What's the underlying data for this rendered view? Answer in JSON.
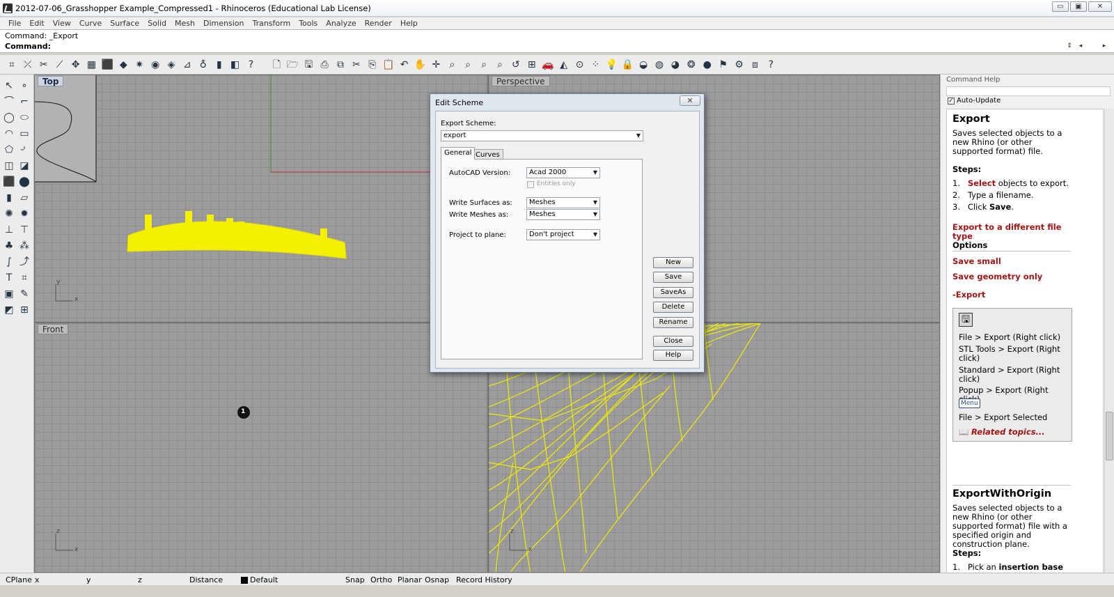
{
  "window": {
    "title": "2012-07-06_Grasshopper Example_Compressed1 - Rhinoceros (Educational Lab License)",
    "min_glyph": "▭",
    "max_glyph": "▣",
    "close_glyph": "✕"
  },
  "menu": [
    "File",
    "Edit",
    "View",
    "Curve",
    "Surface",
    "Solid",
    "Mesh",
    "Dimension",
    "Transform",
    "Tools",
    "Analyze",
    "Render",
    "Help"
  ],
  "command": {
    "history": "Command: _Export",
    "prompt": "Command:",
    "input_value": "",
    "spin_glyph": "⇕",
    "left_glyph": "◂",
    "right_glyph": "▸"
  },
  "toolbar_icons": [
    {
      "name": "snap-icon",
      "glyph": "⌗"
    },
    {
      "name": "curve-tools-icon",
      "glyph": "⤫"
    },
    {
      "name": "trim-icon",
      "glyph": "✂"
    },
    {
      "name": "split-icon",
      "glyph": "⟋"
    },
    {
      "name": "move-icon",
      "glyph": "✥"
    },
    {
      "name": "array-icon",
      "glyph": "▦"
    },
    {
      "name": "box-icon",
      "glyph": "⬛"
    },
    {
      "name": "solid-tools-icon",
      "glyph": "◆"
    },
    {
      "name": "mesh-icon",
      "glyph": "✷"
    },
    {
      "name": "render-icon",
      "glyph": "◉"
    },
    {
      "name": "material-icon",
      "glyph": "◈"
    },
    {
      "name": "dimension-icon",
      "glyph": "⊿"
    },
    {
      "name": "light-icon",
      "glyph": "♁"
    },
    {
      "name": "analyze-icon",
      "glyph": "▮"
    },
    {
      "name": "layer-icon",
      "glyph": "◧"
    },
    {
      "name": "help-icon",
      "glyph": "?"
    },
    {
      "name": "new-file-icon",
      "glyph": "🗋"
    },
    {
      "name": "open-folder-icon",
      "glyph": "🗁"
    },
    {
      "name": "save-icon",
      "glyph": "🖫"
    },
    {
      "name": "print-icon",
      "glyph": "⎙"
    },
    {
      "name": "copy-icon",
      "glyph": "⧉"
    },
    {
      "name": "cut-icon",
      "glyph": "✂"
    },
    {
      "name": "paste-icon",
      "glyph": "⎘"
    },
    {
      "name": "clipboard-icon",
      "glyph": "📋"
    },
    {
      "name": "undo-icon",
      "glyph": "↶"
    },
    {
      "name": "pan-icon",
      "glyph": "✋"
    },
    {
      "name": "rotate-view-icon",
      "glyph": "✛"
    },
    {
      "name": "zoom-icon",
      "glyph": "⌕"
    },
    {
      "name": "zoom-window-icon",
      "glyph": "⌕"
    },
    {
      "name": "zoom-extents-icon",
      "glyph": "⌕"
    },
    {
      "name": "zoom-selected-icon",
      "glyph": "⌕"
    },
    {
      "name": "zoom-previous-icon",
      "glyph": "↺"
    },
    {
      "name": "four-views-icon",
      "glyph": "⊞"
    },
    {
      "name": "car-icon",
      "glyph": "🚗"
    },
    {
      "name": "shaded-icon",
      "glyph": "◭"
    },
    {
      "name": "cplane-icon",
      "glyph": "⊙"
    },
    {
      "name": "points-icon",
      "glyph": "⁘"
    },
    {
      "name": "lightbulb-icon",
      "glyph": "💡"
    },
    {
      "name": "lock-icon",
      "glyph": "🔒"
    },
    {
      "name": "shield-icon",
      "glyph": "◒"
    },
    {
      "name": "color-wheel-icon",
      "glyph": "◍"
    },
    {
      "name": "sphere-icon",
      "glyph": "◕"
    },
    {
      "name": "gear-sphere-icon",
      "glyph": "❂"
    },
    {
      "name": "globe-icon",
      "glyph": "●"
    },
    {
      "name": "flag-icon",
      "glyph": "⚑"
    },
    {
      "name": "gear-icon",
      "glyph": "⚙"
    },
    {
      "name": "grid-icon",
      "glyph": "⧈"
    },
    {
      "name": "help-topic-icon",
      "glyph": "?"
    }
  ],
  "left_tools": [
    {
      "name": "select-arrow-icon",
      "glyph": "↖"
    },
    {
      "name": "point-icon",
      "glyph": "∘"
    },
    {
      "name": "polyline-icon",
      "glyph": "⌒"
    },
    {
      "name": "curve-cv-icon",
      "glyph": "⌐"
    },
    {
      "name": "circle-icon",
      "glyph": "◯"
    },
    {
      "name": "ellipse-icon",
      "glyph": "⬭"
    },
    {
      "name": "arc-icon",
      "glyph": "◠"
    },
    {
      "name": "rectangle-icon",
      "glyph": "▭"
    },
    {
      "name": "polygon-icon",
      "glyph": "⬠"
    },
    {
      "name": "fillet-icon",
      "glyph": "⌏"
    },
    {
      "name": "surface-icon",
      "glyph": "◫"
    },
    {
      "name": "surface-edit-icon",
      "glyph": "◪"
    },
    {
      "name": "box-solid-icon",
      "glyph": "⬛"
    },
    {
      "name": "boolean-icon",
      "glyph": "⬤"
    },
    {
      "name": "cylinder-icon",
      "glyph": "▮"
    },
    {
      "name": "plane-icon",
      "glyph": "▱"
    },
    {
      "name": "transform-gear-icon",
      "glyph": "✺"
    },
    {
      "name": "explode-icon",
      "glyph": "✹"
    },
    {
      "name": "align-icon",
      "glyph": "⊥"
    },
    {
      "name": "distribute-icon",
      "glyph": "⊤"
    },
    {
      "name": "group-icon",
      "glyph": "♣"
    },
    {
      "name": "cluster-icon",
      "glyph": "⁂"
    },
    {
      "name": "blend-icon",
      "glyph": "∫"
    },
    {
      "name": "sweep-icon",
      "glyph": "⤴"
    },
    {
      "name": "text-icon",
      "glyph": "T"
    },
    {
      "name": "block-icon",
      "glyph": "⌗"
    },
    {
      "name": "array-grid-icon",
      "glyph": "▣"
    },
    {
      "name": "edit-curve-icon",
      "glyph": "✎"
    },
    {
      "name": "view-cube-icon",
      "glyph": "◩"
    },
    {
      "name": "dim-tool-icon",
      "glyph": "⊞"
    }
  ],
  "viewports": {
    "top": {
      "label": "Top",
      "axis_x": "x",
      "axis_y": "y"
    },
    "perspective": {
      "label": "Perspective"
    },
    "front": {
      "label": "Front",
      "axis_x": "x",
      "axis_z": "z",
      "marker": "1"
    },
    "right": {
      "axis_x": "x",
      "axis_z": "z"
    }
  },
  "dialog": {
    "title": "Edit Scheme",
    "close_glyph": "✕",
    "export_scheme_label": "Export Scheme:",
    "export_scheme_value": "export",
    "tabs": [
      "General",
      "Curves"
    ],
    "autocad_label": "AutoCAD Version:",
    "autocad_value": "Acad 2000",
    "entities_only_label": "Entities only",
    "write_surfaces_label": "Write Surfaces as:",
    "write_surfaces_value": "Meshes",
    "write_meshes_label": "Write Meshes as:",
    "write_meshes_value": "Meshes",
    "project_label": "Project to plane:",
    "project_value": "Don't project",
    "buttons": {
      "new": "New",
      "save": "Save",
      "saveas": "SaveAs",
      "delete": "Delete",
      "rename": "Rename",
      "close": "Close",
      "help": "Help"
    }
  },
  "help": {
    "header": "Command Help",
    "auto_update": "Auto-Update",
    "check_glyph": "✓",
    "title": "Export",
    "desc": "Saves selected objects to a new Rhino (or other supported format) file.",
    "steps_header": "Steps:",
    "step1_num": "1.",
    "step1_link": "Select",
    "step1_rest": "objects to export.",
    "step2_num": "2.",
    "step2": "Type a filename.",
    "step3_num": "3.",
    "step3_pre": "Click",
    "step3_bold": "Save",
    "export_diff": "Export to a different file type",
    "options_header": "Options",
    "save_small": "Save small",
    "save_geometry": "Save geometry only",
    "dash_export": "-Export",
    "how1": "File > Export (Right click)",
    "how2": "STL Tools > Export (Right click)",
    "how3": "Standard > Export (Right click)",
    "how4": "Popup > Export (Right click)",
    "menu_button": "Menu",
    "how5": "File > Export Selected",
    "related": "Related topics...",
    "title2": "ExportWithOrigin",
    "desc2": "Saves selected objects to a new Rhino (or other supported format) file with a specified origin and construction plane.",
    "steps2_header": "Steps:",
    "step2_1_num": "1.",
    "step2_1_pre": "Pick an",
    "step2_1_bold": "insertion base"
  },
  "status": {
    "cplane": "CPlane",
    "x": "x",
    "y": "y",
    "z": "z",
    "distance": "Distance",
    "layer": "Default",
    "snap": "Snap",
    "ortho": "Ortho",
    "planar": "Planar",
    "osnap": "Osnap",
    "record": "Record History"
  }
}
